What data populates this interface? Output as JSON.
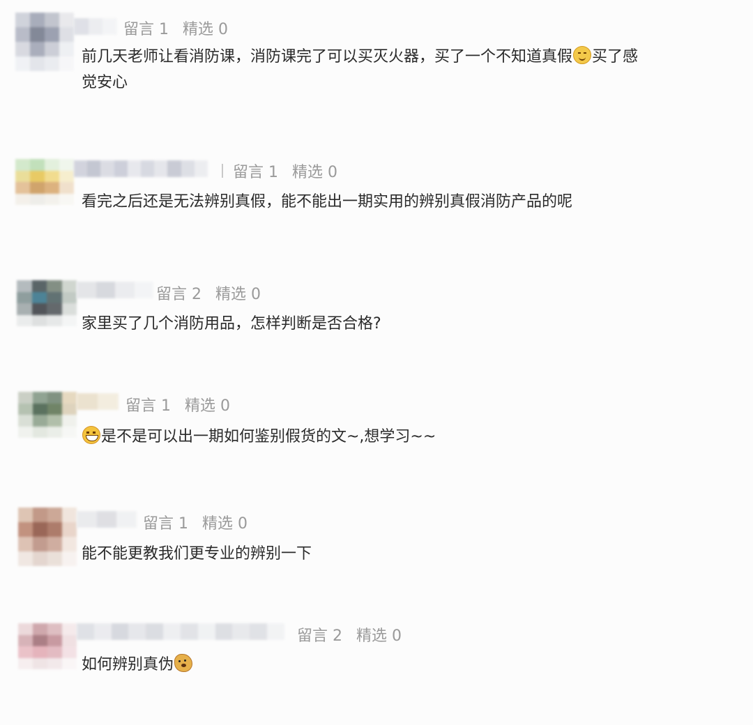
{
  "comments": [
    {
      "meta": {
        "liuyan": "留言 1",
        "jingxuan": "精选 0"
      },
      "lines": [
        "前几天老师让看消防课，消防课完了可以买灭火器，买了一个不知道真假",
        "买了感",
        "觉安心"
      ],
      "emoji": "smile-face-icon",
      "avatar_colors": [
        "#c9ccd6",
        "#9aa0b0",
        "#b8bcc6",
        "#e6e6ea",
        "#aeb2c0",
        "#6f7587",
        "#8c92a4",
        "#d9dbe2",
        "#d2d4dc",
        "#9ca1b1",
        "#c4c7d1",
        "#eceef2",
        "#eef0f4",
        "#dfe1e8",
        "#e8eaee",
        "#f6f6f8"
      ],
      "name_colors": [
        "#d8dae2",
        "#e9eaee",
        "#f2f3f5"
      ]
    },
    {
      "meta": {
        "liuyan": "留言 1",
        "jingxuan": "精选 0"
      },
      "lines": [
        "看完之后还是无法辨别真假，能不能出一期实用的辨别真假消防产品的呢"
      ],
      "avatar_colors": [
        "#cde6c4",
        "#b8dcb0",
        "#dfeed8",
        "#eef5ea",
        "#e8d98a",
        "#e5c24b",
        "#f0d77c",
        "#f6ecc6",
        "#e0b88a",
        "#c99554",
        "#d7a66a",
        "#efdcc4",
        "#f3efe8",
        "#ecebe6",
        "#f2f0ea",
        "#f8f7f3"
      ],
      "name_colors": [
        "#c8cad6",
        "#b7bac8",
        "#d3d5de",
        "#c2c5d2",
        "#e3e4ea",
        "#cfd1db",
        "#e0e1e7",
        "#bdc0cc",
        "#d6d8e0",
        "#e9eaee"
      ]
    },
    {
      "meta": {
        "liuyan": "留言 2",
        "jingxuan": "精选 0"
      },
      "lines": [
        "家里买了几个消防用品，怎样判断是否合格?"
      ],
      "avatar_colors": [
        "#a8b0b4",
        "#3e4b4e",
        "#6f7d70",
        "#c9d0c8",
        "#7c8e8e",
        "#2f6f86",
        "#475a5c",
        "#b8c2bb",
        "#9aa3a4",
        "#35393e",
        "#4a5054",
        "#d5d9d6",
        "#e8eaea",
        "#d9dcdc",
        "#e3e5e5",
        "#f3f4f4"
      ],
      "name_colors": [
        "#dfe0e4",
        "#cfd1d7",
        "#e8e9ec",
        "#f2f3f5"
      ]
    },
    {
      "meta": {
        "liuyan": "留言 1",
        "jingxuan": "精选 0"
      },
      "lines": [
        "是不是可以出一期如何鉴别假货的文~,想学习~~"
      ],
      "emoji": "grin-face-icon",
      "avatar_colors": [
        "#c2c8bc",
        "#7e9480",
        "#6b806c",
        "#e3d3b6",
        "#a9b8a5",
        "#3f5a44",
        "#58704e",
        "#d9cdb3",
        "#d4dbd0",
        "#889d86",
        "#a5b59c",
        "#eef0ea",
        "#eef1ec",
        "#dfe5dc",
        "#e8ece5",
        "#f6f7f4"
      ],
      "name_colors": [
        "#e8dcc4",
        "#f1ead9"
      ]
    },
    {
      "meta": {
        "liuyan": "留言 1",
        "jingxuan": "精选 0"
      },
      "lines": [
        "能不能更教我们更专业的辨别一下"
      ],
      "avatar_colors": [
        "#d9bca8",
        "#b88874",
        "#c49a86",
        "#efe2d8",
        "#b8806a",
        "#8a4e3c",
        "#a06652",
        "#e6cfc2",
        "#d8b8a8",
        "#b98c7c",
        "#c8a090",
        "#f1e4dc",
        "#eee4de",
        "#e0d0c8",
        "#e8dcd4",
        "#f7f1ee"
      ],
      "name_colors": [
        "#e6e7ea",
        "#d8d9de",
        "#eeeff1"
      ]
    },
    {
      "meta": {
        "liuyan": "留言 2",
        "jingxuan": "精选 0"
      },
      "lines": [
        "如何辨别真伪"
      ],
      "emoji": "doge-face-icon",
      "avatar_colors": [
        "#ead4d6",
        "#c89aa0",
        "#d9b4b8",
        "#f4e8e9",
        "#d1a7ad",
        "#9e6a72",
        "#c08a92",
        "#eedcde",
        "#e8b8c0",
        "#e2a8b2",
        "#dfb0b8",
        "#f2dde1",
        "#f5eced",
        "#ede0e2",
        "#f1e6e8",
        "#faf5f6"
      ],
      "name_colors": [
        "#d9dbe1",
        "#e7e8ec",
        "#cfd1d8",
        "#e1e2e7",
        "#d4d6dc",
        "#ebecef",
        "#dcdee3",
        "#eef0f2",
        "#d6d8de",
        "#e4e5e9",
        "#dadce1",
        "#f0f1f3"
      ]
    }
  ]
}
